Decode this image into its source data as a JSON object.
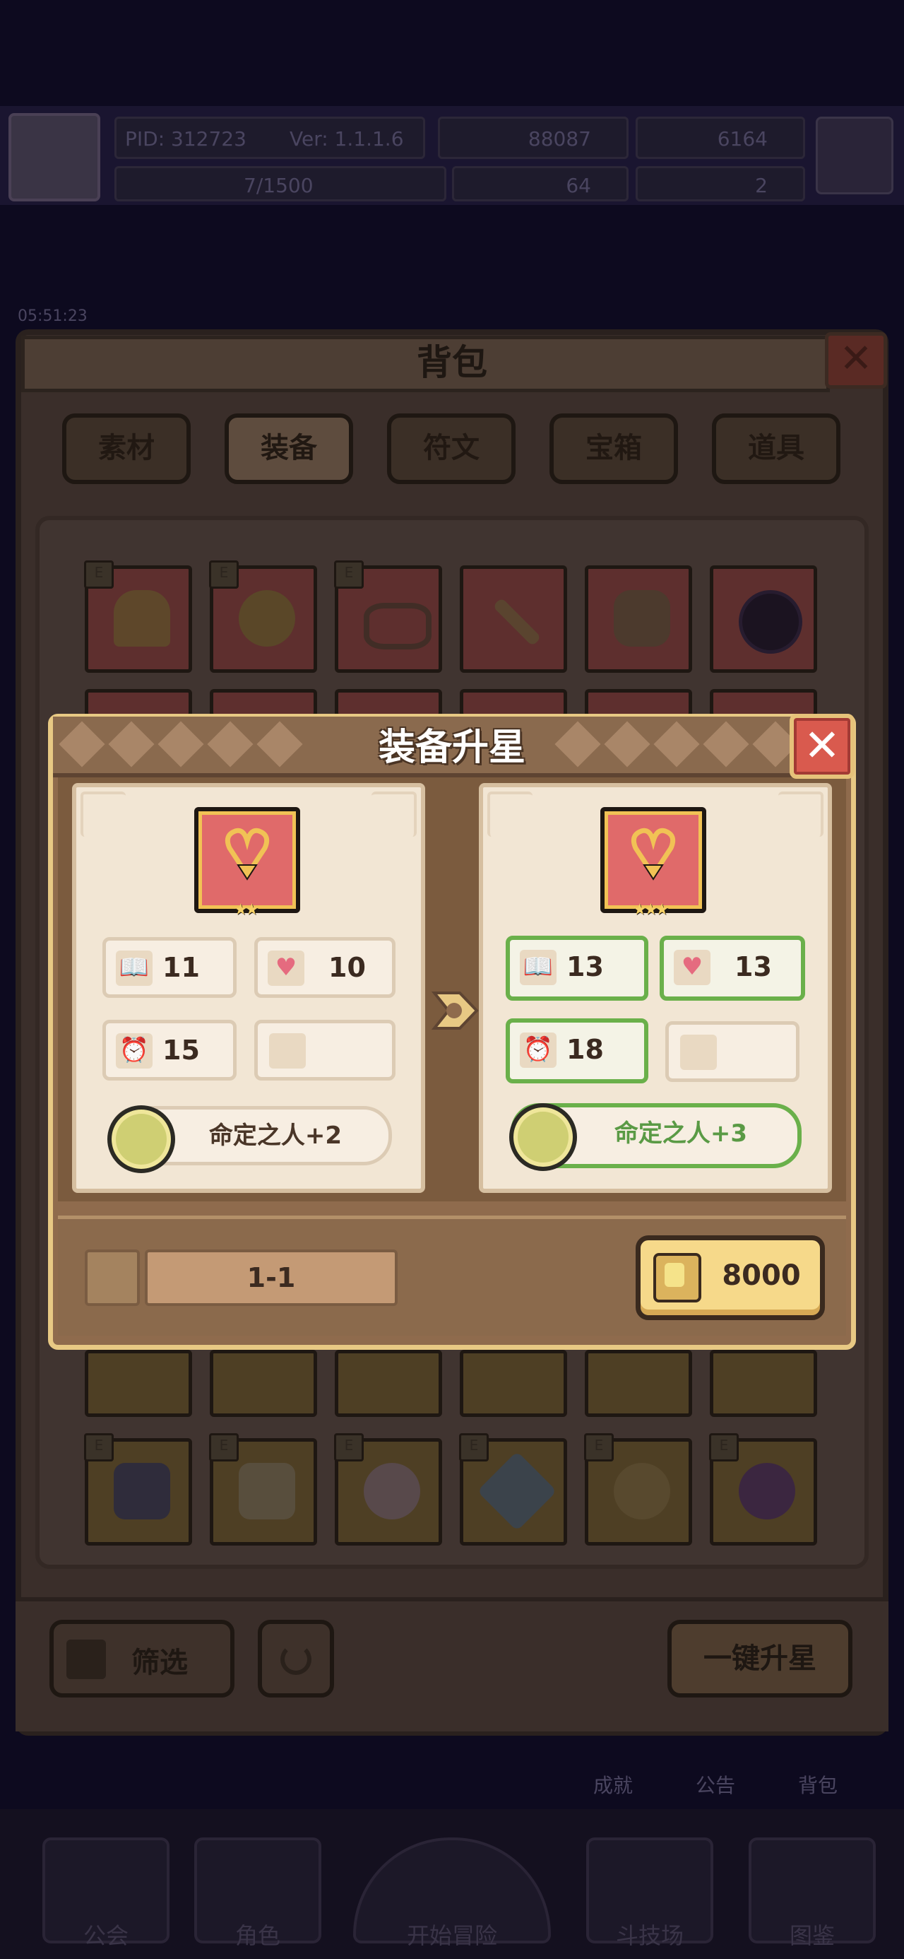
{
  "hud": {
    "pid": "PID: 312723",
    "version": "Ver: 1.1.1.6",
    "gold": "88087",
    "gems": "6164",
    "exp": "7/1500",
    "clover": "64",
    "potion": "2",
    "timer": "05:51:23"
  },
  "backpack": {
    "title": "背包",
    "close": "✕",
    "tabs": [
      "素材",
      "装备",
      "符文",
      "宝箱",
      "道具"
    ],
    "filter_label": "筛选",
    "one_key_label": "一键升星"
  },
  "nav": [
    "公会",
    "角色",
    "开始冒险",
    "斗技场",
    "图鉴"
  ],
  "side_nav": [
    "成就",
    "公告",
    "背包"
  ],
  "dialog": {
    "title": "装备升星",
    "close": "✕",
    "before": {
      "stats": [
        {
          "icon": "book-icon",
          "value": "11"
        },
        {
          "icon": "heart-icon",
          "value": "10"
        },
        {
          "icon": "clock-icon",
          "value": "15"
        },
        {
          "icon": "empty-icon",
          "value": ""
        }
      ],
      "skill": "命定之人+2",
      "stars": "★★"
    },
    "after": {
      "stats": [
        {
          "icon": "book-icon",
          "value": "13"
        },
        {
          "icon": "heart-icon",
          "value": "13"
        },
        {
          "icon": "clock-icon",
          "value": "18"
        },
        {
          "icon": "empty-icon",
          "value": ""
        }
      ],
      "skill": "命定之人+3",
      "stars": "★★★"
    },
    "stage": "1-1",
    "cost": "8000"
  },
  "colors": {
    "upgrade_green": "#6ab04a",
    "gold_button": "#f6d98a",
    "close_red": "#d95a4e",
    "dialog_brown": "#8f6b4d"
  }
}
